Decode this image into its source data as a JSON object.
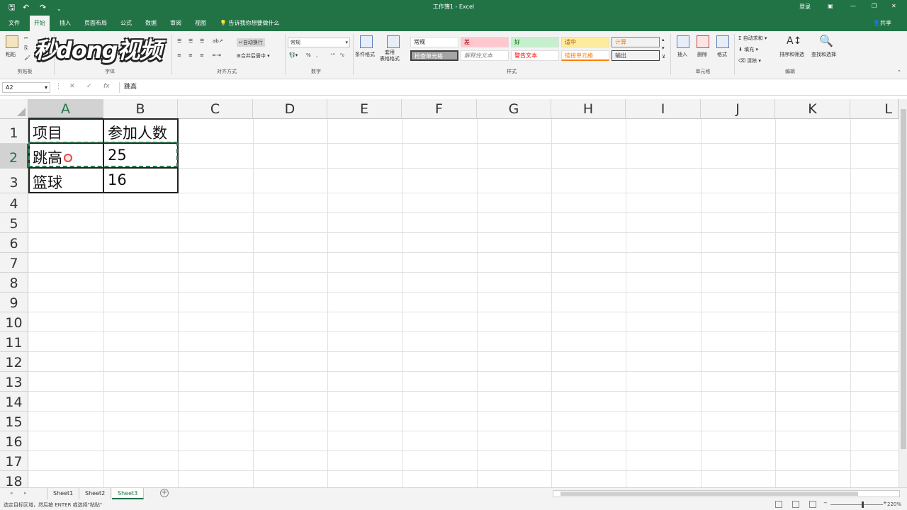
{
  "titlebar": {
    "title": "工作簿1 - Excel",
    "signin": "登录"
  },
  "tabs": [
    "文件",
    "开始",
    "插入",
    "页面布局",
    "公式",
    "数据",
    "审阅",
    "视图"
  ],
  "active_tab": "开始",
  "tellme": "告诉我你想要做什么",
  "share": "共享",
  "ribbon": {
    "clipboard": {
      "paste": "粘贴",
      "label": "剪贴板"
    },
    "font": {
      "label": "字体"
    },
    "alignment": {
      "wrap": "自动换行",
      "merge": "合并后居中",
      "label": "对齐方式"
    },
    "number": {
      "format": "常规",
      "label": "数字"
    },
    "styles": {
      "conditional": "条件格式",
      "table": "套用\n表格格式",
      "label": "样式",
      "cells": [
        "常规",
        "差",
        "好",
        "适中",
        "计算",
        "检查单元格",
        "解释性文本",
        "警告文本",
        "链接单元格",
        "输出"
      ]
    },
    "cells_group": {
      "insert": "插入",
      "delete": "删除",
      "format": "格式",
      "label": "单元格"
    },
    "editing": {
      "autosum": "自动求和",
      "fill": "填充",
      "clear": "清除",
      "sort": "排序和筛选",
      "find": "查找和选择",
      "label": "编辑"
    }
  },
  "logo": "秒dong视频",
  "formula_bar": {
    "name_box": "A2",
    "content": "跳高"
  },
  "columns": [
    "A",
    "B",
    "C",
    "D",
    "E",
    "F",
    "G",
    "H",
    "I",
    "J",
    "K",
    "L"
  ],
  "rows": [
    "1",
    "2",
    "3",
    "4",
    "5",
    "6",
    "7",
    "8",
    "9",
    "10",
    "11",
    "12",
    "13",
    "14",
    "15",
    "16",
    "17",
    "18"
  ],
  "cells": {
    "A1": "项目",
    "B1": "参加人数",
    "A2": "跳高",
    "B2": "25",
    "A3": "篮球",
    "B3": "16"
  },
  "selected_cell": "A2",
  "sheets": [
    "Sheet1",
    "Sheet2",
    "Sheet3"
  ],
  "active_sheet": "Sheet3",
  "status": {
    "message": "选定目标区域，然后按 ENTER 或选择\"粘贴\"",
    "zoom": "220%"
  },
  "colors": {
    "accent": "#217346",
    "marquee": "#2c7a52"
  }
}
